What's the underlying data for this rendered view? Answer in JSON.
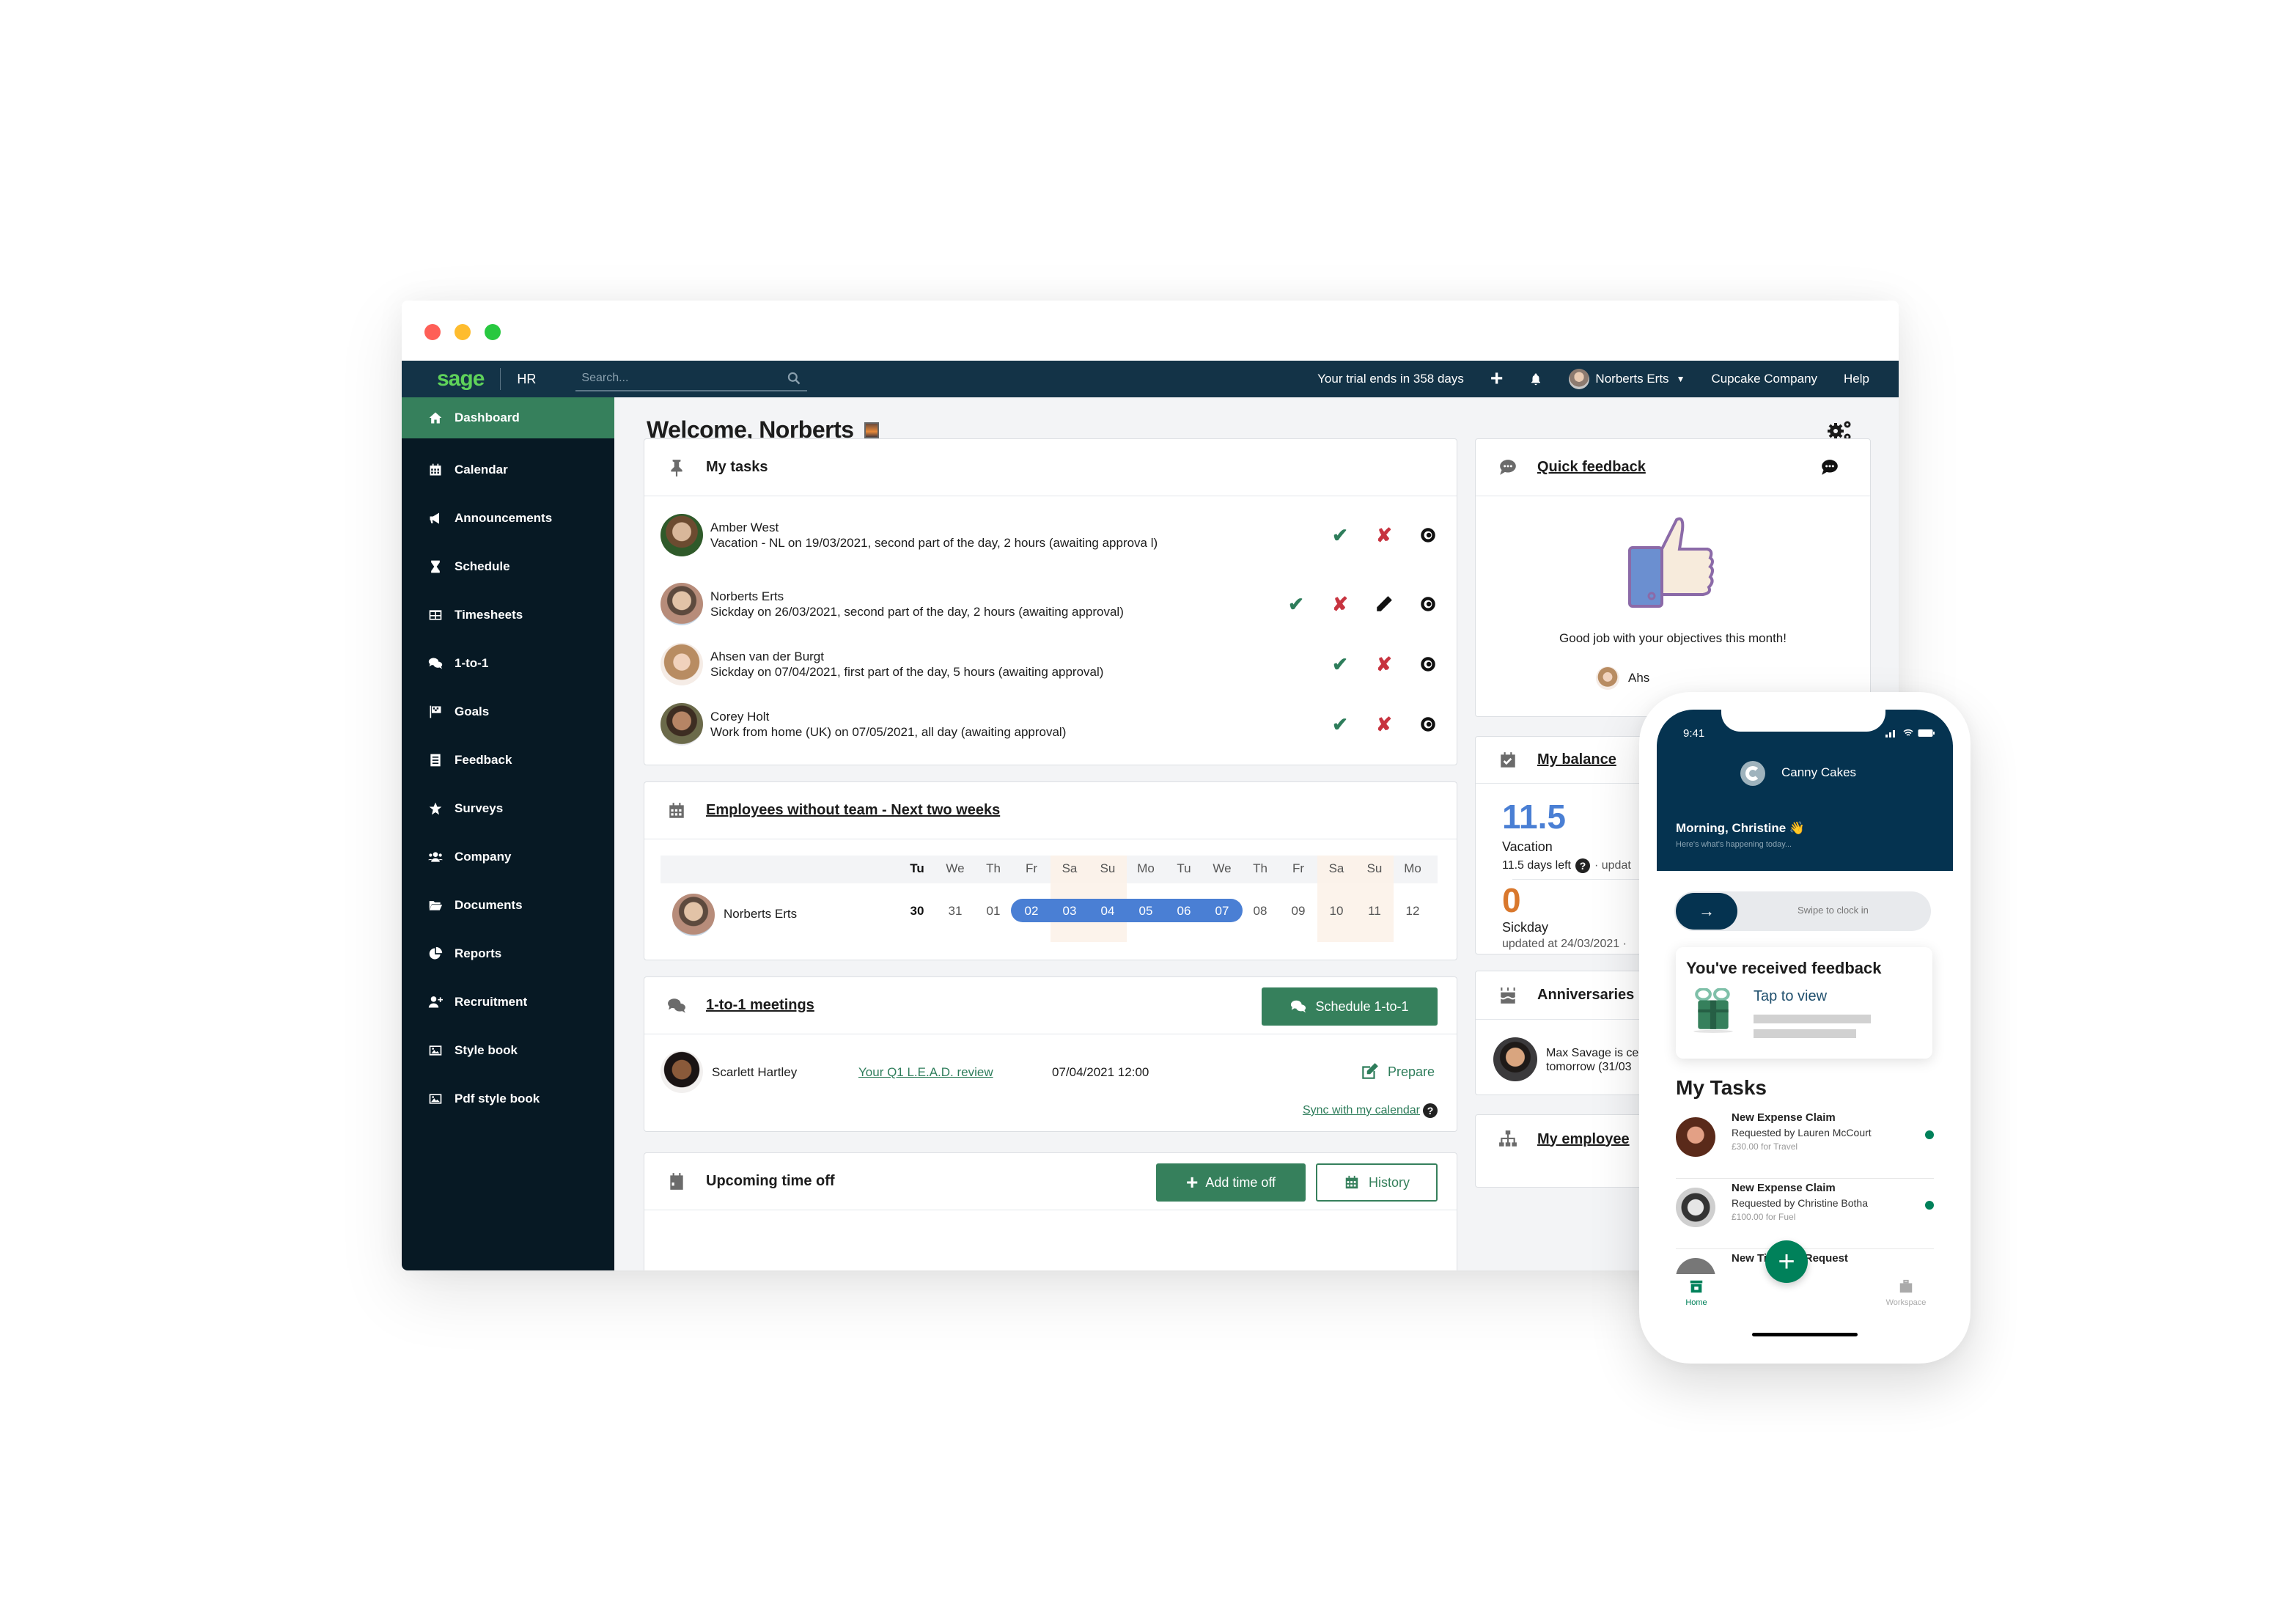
{
  "header": {
    "logo": "sage",
    "app": "HR",
    "search_placeholder": "Search...",
    "trial": "Your trial ends in 358 days",
    "user": "Norberts Erts",
    "company": "Cupcake Company",
    "help": "Help"
  },
  "sidebar": {
    "items": [
      {
        "label": "Dashboard",
        "icon": "home-icon",
        "active": true
      },
      {
        "label": "Calendar",
        "icon": "calendar-icon"
      },
      {
        "label": "Announcements",
        "icon": "megaphone-icon"
      },
      {
        "label": "Schedule",
        "icon": "hourglass-icon"
      },
      {
        "label": "Timesheets",
        "icon": "table-icon"
      },
      {
        "label": "1-to-1",
        "icon": "comments-icon"
      },
      {
        "label": "Goals",
        "icon": "flag-checkered-icon"
      },
      {
        "label": "Feedback",
        "icon": "list-icon"
      },
      {
        "label": "Surveys",
        "icon": "star-icon"
      },
      {
        "label": "Company",
        "icon": "users-icon"
      },
      {
        "label": "Documents",
        "icon": "folder-open-icon"
      },
      {
        "label": "Reports",
        "icon": "pie-chart-icon"
      },
      {
        "label": "Recruitment",
        "icon": "user-plus-icon"
      },
      {
        "label": "Style book",
        "icon": "image-icon"
      },
      {
        "label": "Pdf style book",
        "icon": "image-icon"
      }
    ]
  },
  "main": {
    "welcome": "Welcome, Norberts",
    "tasks": {
      "title": "My tasks",
      "rows": [
        {
          "name": "Amber West",
          "detail": "Vacation - NL on 19/03/2021, second part of the day, 2 hours (awaiting approva l)",
          "edit": false
        },
        {
          "name": "Norberts Erts",
          "detail": "Sickday on 26/03/2021, second part of the day, 2 hours (awaiting approval)",
          "edit": true
        },
        {
          "name": "Ahsen van der Burgt",
          "detail": "Sickday on 07/04/2021, first part of the day, 5 hours (awaiting approval)",
          "edit": false
        },
        {
          "name": "Corey Holt",
          "detail": "Work from home (UK) on 07/05/2021, all day (awaiting approval)",
          "edit": false
        }
      ]
    },
    "employees": {
      "title": "Employees without team - Next two weeks",
      "days": [
        "Tu",
        "We",
        "Th",
        "Fr",
        "Sa",
        "Su",
        "Mo",
        "Tu",
        "We",
        "Th",
        "Fr",
        "Sa",
        "Su",
        "Mo"
      ],
      "dates": [
        "30",
        "31",
        "01",
        "02",
        "03",
        "04",
        "05",
        "06",
        "07",
        "08",
        "09",
        "10",
        "11",
        "12"
      ],
      "employee": "Norberts Erts",
      "highlight_from": 3,
      "highlight_to": 8,
      "weekends": [
        4,
        5,
        11,
        12
      ]
    },
    "meetings": {
      "title": "1-to-1 meetings",
      "schedule_btn": "Schedule 1-to-1",
      "person": "Scarlett Hartley",
      "topic": "Your Q1 L.E.A.D. review",
      "datetime": "07/04/2021 12:00",
      "prepare": "Prepare",
      "sync": "Sync with my calendar"
    },
    "timeoff": {
      "title": "Upcoming time off",
      "add_btn": "Add time off",
      "history_btn": "History"
    }
  },
  "right": {
    "quick_feedback": {
      "title": "Quick feedback",
      "message": "Good job with your objectives this month!",
      "author": "Ahs"
    },
    "balance": {
      "title": "My balance",
      "vacation_value": "11.5",
      "vacation_label": "Vacation",
      "vacation_detail": "11.5 days left",
      "vacation_suffix": "· updat",
      "sick_value": "0",
      "sick_label": "Sickday",
      "sick_detail": "updated at 24/03/2021 ·"
    },
    "anniversaries": {
      "title": "Anniversaries",
      "line1": "Max Savage is ce",
      "line2": "tomorrow (31/03"
    },
    "employees": {
      "title": "My employee"
    }
  },
  "phone": {
    "time": "9:41",
    "company": "Canny Cakes",
    "greeting": "Morning, Christine 👋",
    "subgreeting": "Here's what's happening today...",
    "swipe": "Swipe to clock in",
    "feedback_title": "You've received feedback",
    "feedback_cta": "Tap to view",
    "tasks_title": "My Tasks",
    "tasks": [
      {
        "title": "New Expense Claim",
        "by": "Requested by Lauren McCourt",
        "amount": "£30.00 for Travel"
      },
      {
        "title": "New Expense Claim",
        "by": "Requested by Christine Botha",
        "amount": "£100.00 for Fuel"
      },
      {
        "title": "New Time Off Request",
        "by": "",
        "amount": ""
      }
    ],
    "nav_home": "Home",
    "nav_workspace": "Workspace"
  },
  "colors": {
    "brand_green": "#36805c",
    "topbar": "#133347",
    "sidebar": "#071924",
    "range_blue": "#4a7fd4",
    "balance_blue": "#4a7fd4",
    "balance_orange": "#d9782d",
    "phone_navy": "#053350",
    "phone_green": "#00815a"
  }
}
